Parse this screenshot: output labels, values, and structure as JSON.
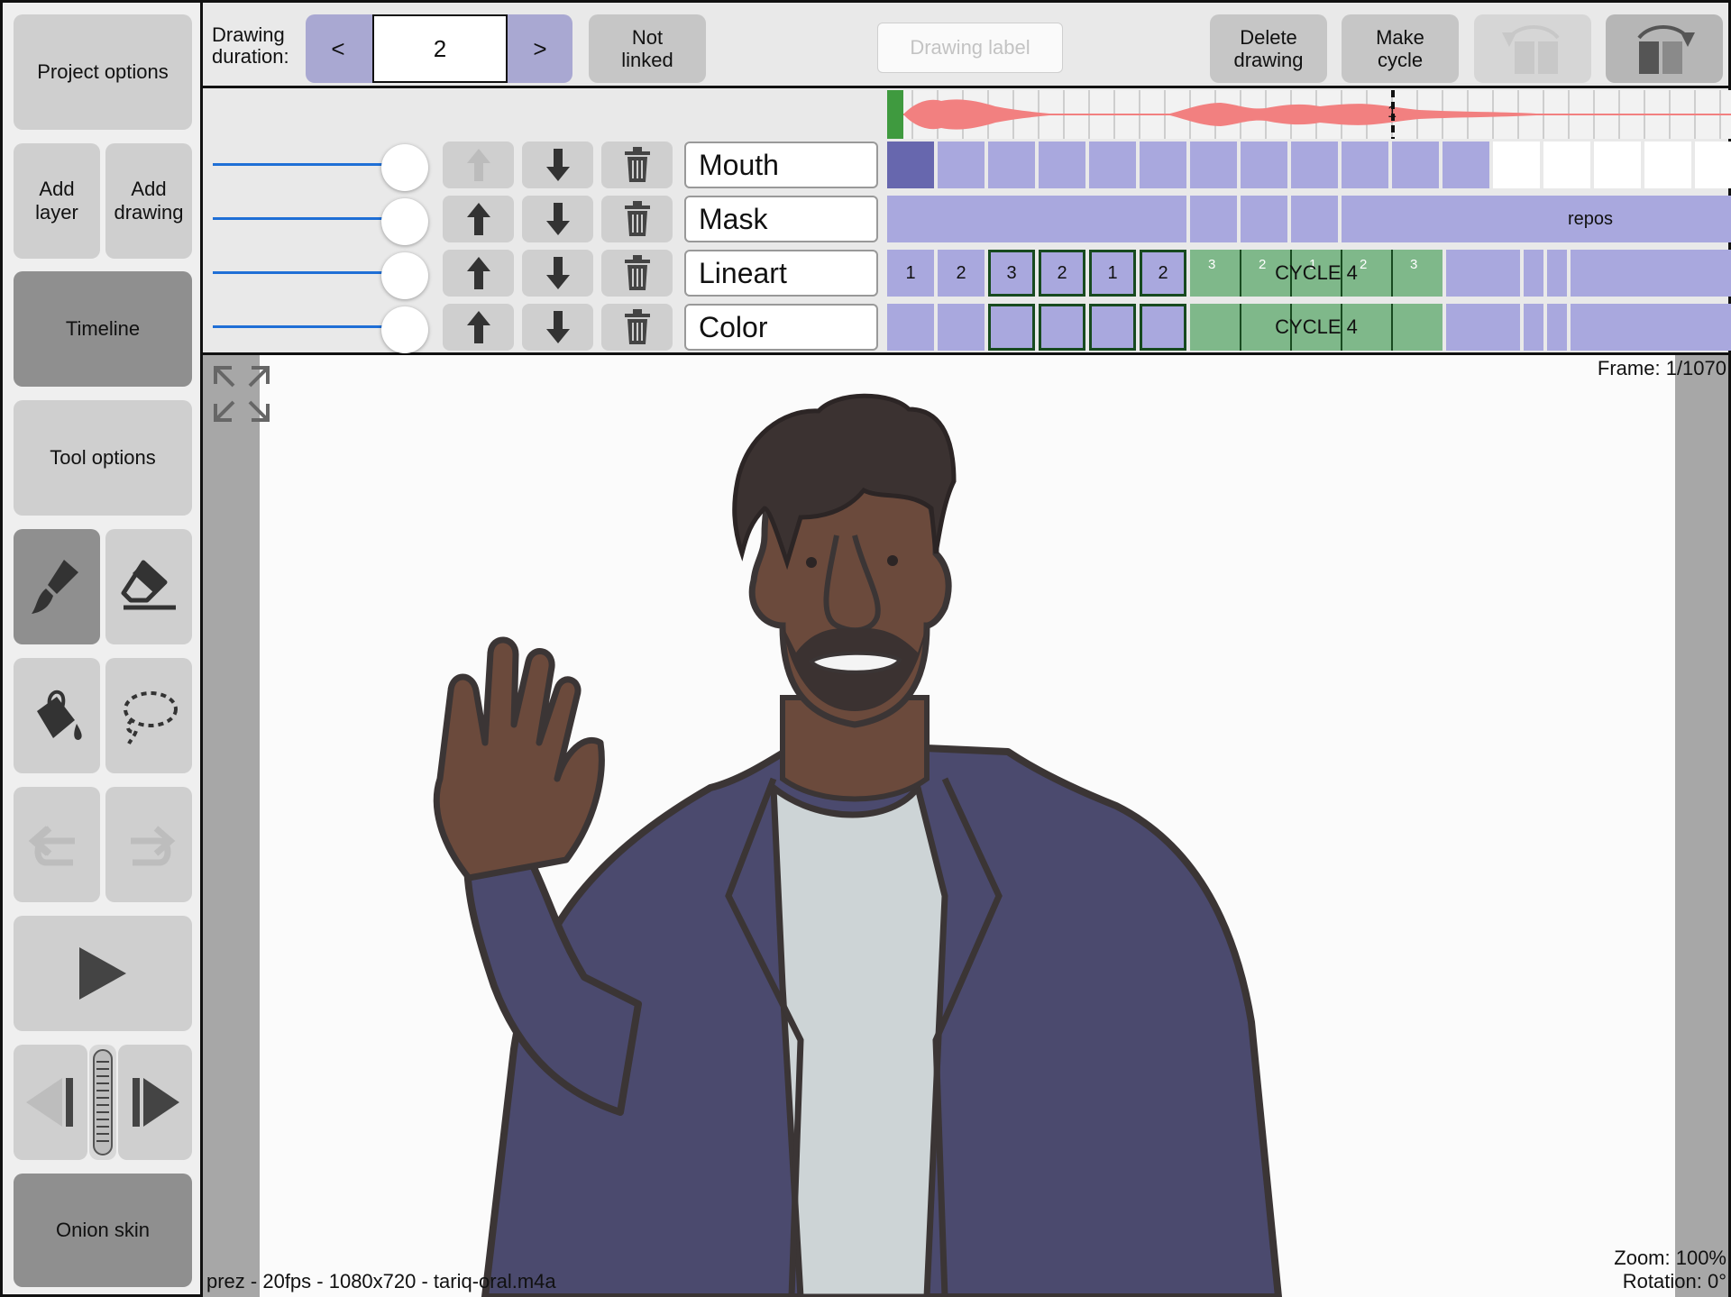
{
  "sidebar": {
    "project_options": "Project options",
    "add_layer": "Add\nlayer",
    "add_drawing": "Add\ndrawing",
    "timeline": "Timeline",
    "tool_options": "Tool options",
    "onion_skin": "Onion skin"
  },
  "topbar": {
    "duration_label_1": "Drawing",
    "duration_label_2": "duration:",
    "prev": "<",
    "next": ">",
    "duration_value": "2",
    "not_linked_1": "Not",
    "not_linked_2": "linked",
    "drawing_label_placeholder": "Drawing label",
    "delete_1": "Delete",
    "delete_2": "drawing",
    "cycle_1": "Make",
    "cycle_2": "cycle"
  },
  "timeline": {
    "marker_label": "1",
    "layers": [
      {
        "name": "Mouth"
      },
      {
        "name": "Mask",
        "span_label": "repos"
      },
      {
        "name": "Lineart",
        "cells": [
          "1",
          "2",
          "3",
          "2",
          "1",
          "2"
        ],
        "cycle_label": "CYCLE 4",
        "mini": [
          "3",
          "2",
          "1",
          "2",
          "3"
        ]
      },
      {
        "name": "Color",
        "cycle_label": "CYCLE 4"
      }
    ]
  },
  "canvas": {
    "frame": "Frame: 1/1070",
    "info": "prez - 20fps - 1080x720 - tariq-oral.m4a",
    "zoom": "Zoom: 100%",
    "rotation": "Rotation: 0°"
  },
  "colors": {
    "cell_purple": "#a9a8de",
    "cell_selected": "#6767ae",
    "cycle_green": "#7fb88a",
    "audio_wave": "#f28080",
    "slider_blue": "#1f6fd6"
  }
}
